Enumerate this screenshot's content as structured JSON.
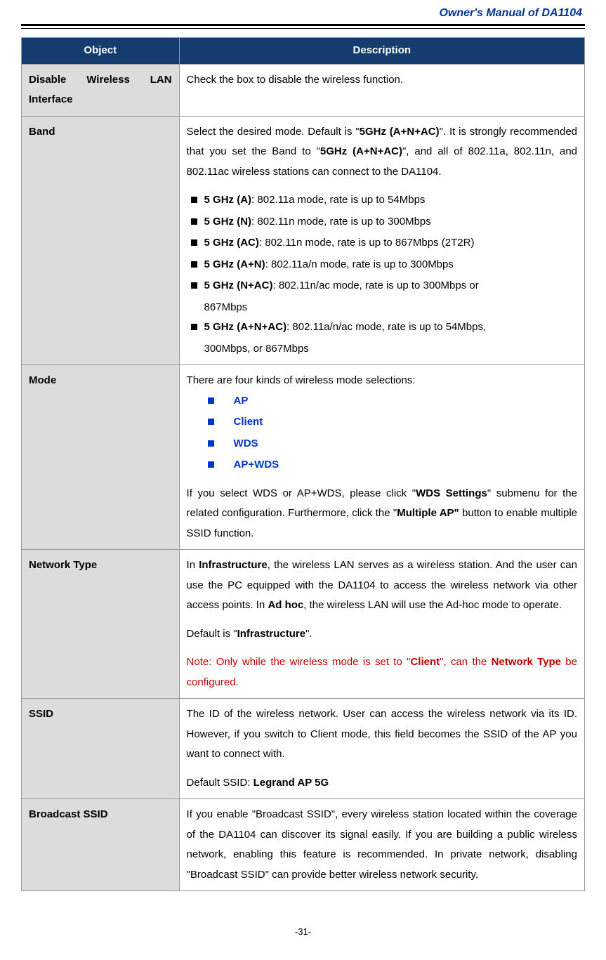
{
  "header": "Owner's Manual of DA1104",
  "pagenum": "-31-",
  "table": {
    "h1": "Object",
    "h2": "Description",
    "rows": {
      "disable": {
        "obj1": "Disable",
        "obj2": "Wireless",
        "obj3": "LAN",
        "obj4": "Interface",
        "desc": "Check the box to disable the wireless function."
      },
      "band": {
        "obj": "Band",
        "p1a": "Select the desired mode. Default is \"",
        "p1b": "5GHz (A+N+AC)",
        "p1c": "\". It is strongly recommended that you set the Band to \"",
        "p1d": "5GHz (A+N+AC)",
        "p1e": "\", and all of 802.11a, 802.11n, and 802.11ac wireless stations can connect to the DA1104.",
        "li1b": "5 GHz (A)",
        "li1t": ": 802.11a mode, rate is up to 54Mbps",
        "li2b": "5 GHz (N)",
        "li2t": ": 802.11n mode, rate is up to 300Mbps",
        "li3b": "5 GHz (AC)",
        "li3t": ": 802.11n mode, rate is up to 867Mbps (2T2R)",
        "li4b": "5 GHz (A+N)",
        "li4t": ": 802.11a/n mode, rate is up to 300Mbps",
        "li5b": "5 GHz (N+AC)",
        "li5t": ": 802.11n/ac mode, rate is up to 300Mbps or",
        "li5c": "867Mbps",
        "li6b": "5 GHz (A+N+AC)",
        "li6t": ": 802.11a/n/ac mode, rate is up to 54Mbps,",
        "li6c": "300Mbps, or 867Mbps"
      },
      "mode": {
        "obj": "Mode",
        "p1": "There are four kinds of wireless mode selections:",
        "m1": "AP",
        "m2": "Client",
        "m3": "WDS",
        "m4": "AP+WDS",
        "p2a": "If you select WDS or AP+WDS, please click \"",
        "p2b": "WDS Settings",
        "p2c": "\" submenu for the related configuration. Furthermore, click the \"",
        "p2d": "Multiple AP\"",
        "p2e": " button to enable multiple SSID function."
      },
      "nettype": {
        "obj": "Network Type",
        "p1a": "In ",
        "p1b": "Infrastructure",
        "p1c": ", the wireless LAN serves as a wireless station. And the user can use the PC equipped with the DA1104 to access the wireless network via other access points. In ",
        "p1d": "Ad hoc",
        "p1e": ", the wireless LAN will use the Ad-hoc mode to operate.",
        "p2a": "Default is \"",
        "p2b": "Infrastructure",
        "p2c": "\".",
        "note1": "Note: Only while the wireless mode is set to \"",
        "noteClient": "Client",
        "note2": "\", can the ",
        "noteNT": "Network Type",
        "note3": " be configured."
      },
      "ssid": {
        "obj": "SSID",
        "p1": "The ID of the wireless network. User can access the wireless network via its ID. However, if you switch to Client mode, this field becomes the SSID of the AP you want to connect with.",
        "p2a": "Default SSID: ",
        "p2b": "Legrand AP 5G"
      },
      "bcast": {
        "obj": "Broadcast SSID",
        "p1": "If you enable \"Broadcast SSID\", every wireless station located within the coverage of the DA1104 can discover its signal easily. If you are building a public wireless network, enabling this feature is recommended. In private network, disabling \"Broadcast SSID\" can provide better wireless network security."
      }
    }
  }
}
